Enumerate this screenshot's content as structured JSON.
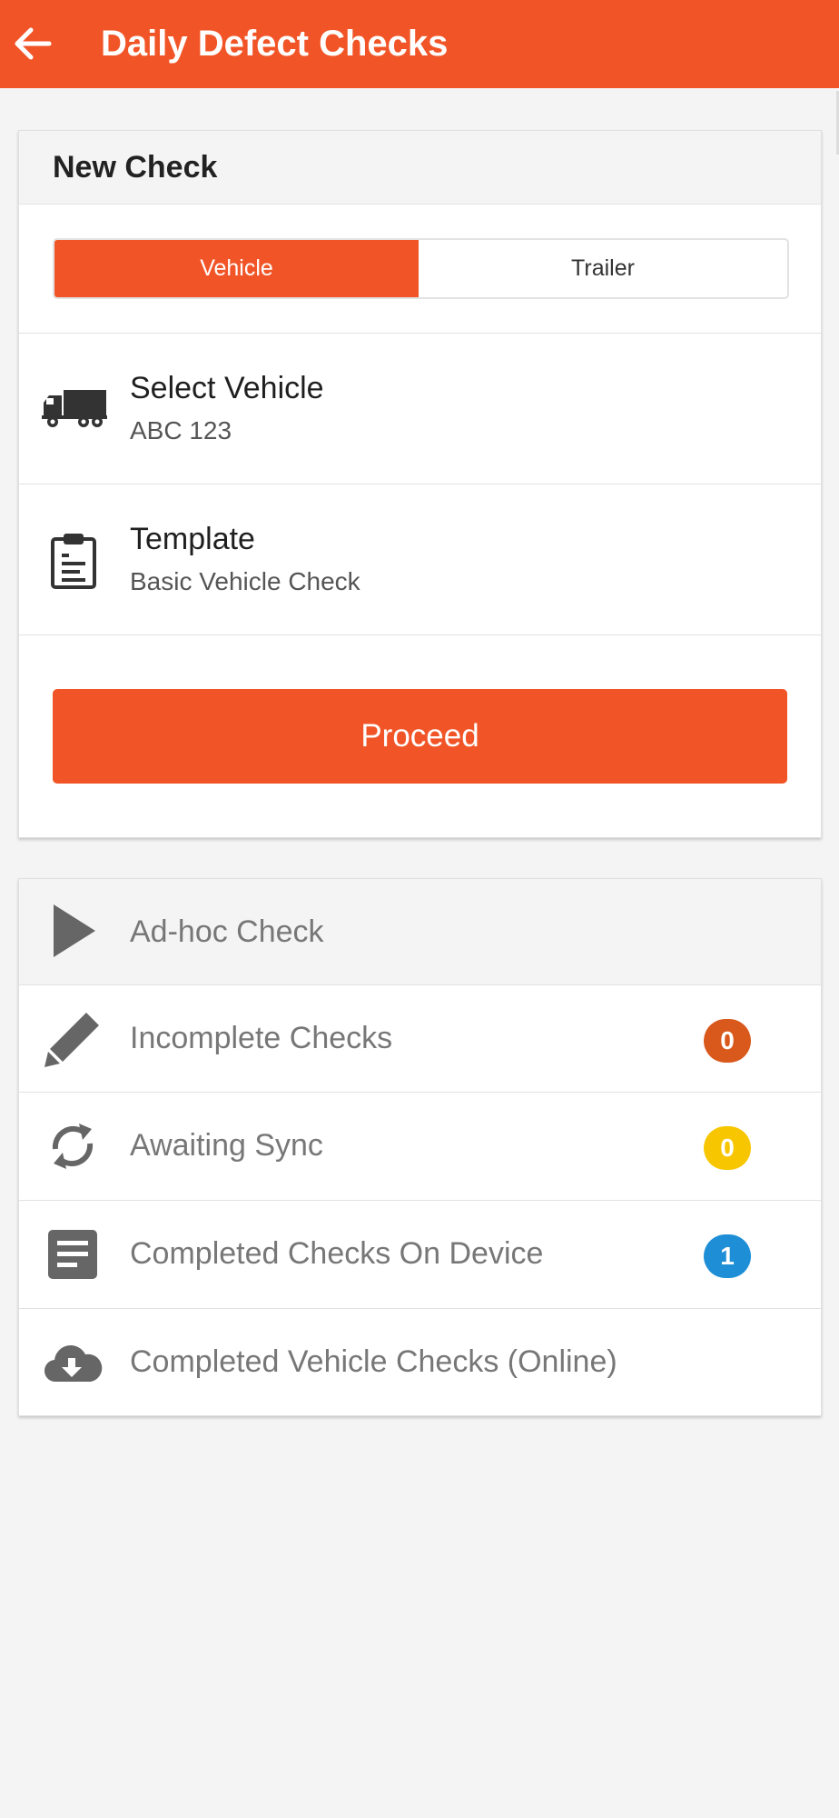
{
  "appbar": {
    "title": "Daily Defect Checks",
    "back_icon": "arrow-left-icon"
  },
  "colors": {
    "accent": "#f15527",
    "badge_incomplete": "#d9581c",
    "badge_awaiting": "#f7c600",
    "badge_completed": "#1e8fd6"
  },
  "new_check": {
    "header": "New Check",
    "segment": {
      "vehicle_label": "Vehicle",
      "trailer_label": "Trailer",
      "selected": "Vehicle"
    },
    "vehicle": {
      "title": "Select Vehicle",
      "value": "ABC 123",
      "icon": "truck-icon"
    },
    "template": {
      "title": "Template",
      "value": "Basic Vehicle Check",
      "icon": "clipboard-icon"
    },
    "proceed_label": "Proceed"
  },
  "menu": {
    "adhoc": {
      "label": "Ad-hoc Check",
      "icon": "play-icon"
    },
    "incomplete": {
      "label": "Incomplete Checks",
      "count": "0",
      "icon": "pencil-icon"
    },
    "awaiting": {
      "label": "Awaiting Sync",
      "count": "0",
      "icon": "sync-icon"
    },
    "completed_device": {
      "label": "Completed Checks On Device",
      "count": "1",
      "icon": "document-icon"
    },
    "completed_online": {
      "label": "Completed Vehicle Checks (Online)",
      "icon": "cloud-download-icon"
    }
  }
}
